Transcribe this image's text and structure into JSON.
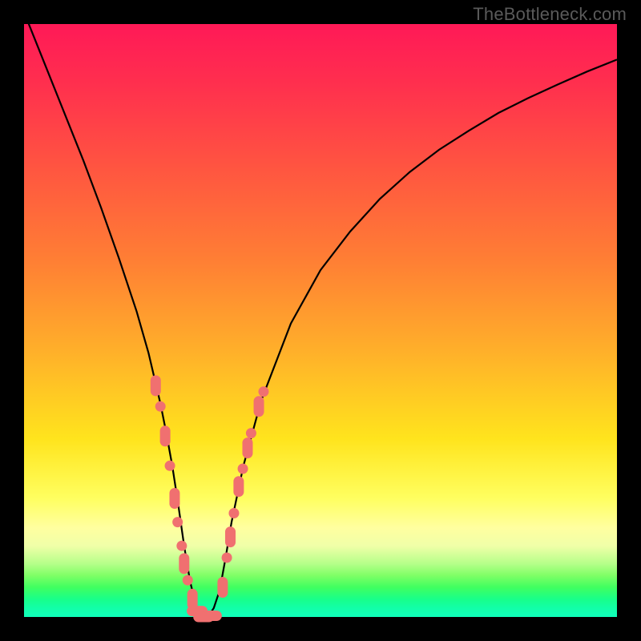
{
  "watermark": "TheBottleneck.com",
  "chart_data": {
    "type": "line",
    "title": "",
    "xlabel": "",
    "ylabel": "",
    "xlim": [
      0,
      100
    ],
    "ylim": [
      0,
      100
    ],
    "grid": false,
    "legend": false,
    "curve": {
      "name": "bottleneck-curve",
      "x": [
        0,
        1,
        2,
        3,
        4,
        5,
        7,
        10,
        13,
        16,
        19,
        21,
        23,
        24,
        25,
        26,
        27,
        28,
        29,
        30,
        31,
        32,
        33,
        34,
        35,
        37,
        40,
        45,
        50,
        55,
        60,
        65,
        70,
        75,
        80,
        85,
        90,
        95,
        100
      ],
      "values": [
        102,
        99.5,
        97,
        94.5,
        92,
        89.5,
        84.5,
        77,
        69,
        60.5,
        51.5,
        44.5,
        36,
        31,
        25.5,
        19,
        12,
        6,
        2,
        0,
        0,
        1.5,
        4.5,
        10,
        16,
        25.5,
        36.5,
        49.5,
        58.5,
        65,
        70.5,
        75,
        78.8,
        82,
        85,
        87.5,
        89.8,
        92,
        94
      ]
    },
    "markers": {
      "name": "data-points",
      "points": [
        {
          "x": 22.2,
          "y": 39.0,
          "shape": "rect_tall"
        },
        {
          "x": 23.0,
          "y": 35.5,
          "shape": "dot"
        },
        {
          "x": 23.8,
          "y": 30.5,
          "shape": "rect_tall"
        },
        {
          "x": 24.6,
          "y": 25.5,
          "shape": "dot"
        },
        {
          "x": 25.4,
          "y": 20.0,
          "shape": "rect_tall"
        },
        {
          "x": 25.9,
          "y": 16.0,
          "shape": "dot"
        },
        {
          "x": 26.6,
          "y": 12.0,
          "shape": "dot"
        },
        {
          "x": 27.0,
          "y": 9.0,
          "shape": "rect_tall"
        },
        {
          "x": 27.6,
          "y": 6.2,
          "shape": "dot"
        },
        {
          "x": 28.4,
          "y": 3.0,
          "shape": "rect_tall"
        },
        {
          "x": 29.2,
          "y": 1.0,
          "shape": "rect_wide"
        },
        {
          "x": 30.3,
          "y": 0.0,
          "shape": "rect_wide"
        },
        {
          "x": 31.6,
          "y": 0.2,
          "shape": "rect_wide"
        },
        {
          "x": 33.5,
          "y": 5.0,
          "shape": "rect_tall"
        },
        {
          "x": 34.2,
          "y": 10.0,
          "shape": "dot"
        },
        {
          "x": 34.8,
          "y": 13.5,
          "shape": "rect_tall"
        },
        {
          "x": 35.4,
          "y": 17.5,
          "shape": "dot"
        },
        {
          "x": 36.2,
          "y": 22.0,
          "shape": "rect_tall"
        },
        {
          "x": 36.9,
          "y": 25.0,
          "shape": "dot"
        },
        {
          "x": 37.7,
          "y": 28.5,
          "shape": "rect_tall"
        },
        {
          "x": 38.3,
          "y": 31.0,
          "shape": "dot"
        },
        {
          "x": 39.6,
          "y": 35.5,
          "shape": "rect_tall"
        },
        {
          "x": 40.4,
          "y": 38.0,
          "shape": "dot"
        }
      ]
    },
    "annotations": []
  },
  "colors": {
    "marker": "#f07070",
    "curve": "#000000",
    "frame": "#000000"
  }
}
